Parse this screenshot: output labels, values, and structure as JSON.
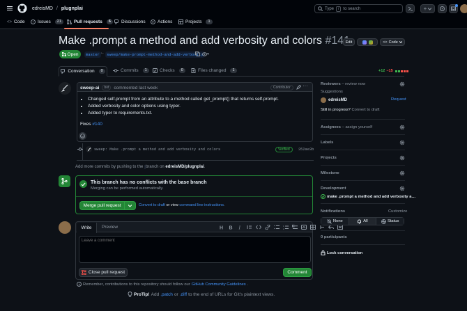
{
  "header": {
    "owner": "edreisMD",
    "slash": "/",
    "repo": "plugnplai",
    "search_placeholder_pre": "Type",
    "search_key": "/",
    "search_placeholder_post": "to search",
    "plus": "+"
  },
  "tabs": [
    {
      "label": "Code",
      "count": ""
    },
    {
      "label": "Issues",
      "count": "21"
    },
    {
      "label": "Pull requests",
      "count": "6"
    },
    {
      "label": "Discussions",
      "count": ""
    },
    {
      "label": "Actions",
      "count": ""
    },
    {
      "label": "Projects",
      "count": "1"
    }
  ],
  "pr": {
    "title": "Make .prompt a method and add verbosity and colors",
    "number": "#141",
    "state": "Open",
    "base": "master",
    "head": "sweep/make-prompt-method-and-add-verbosity",
    "edit": "Edit",
    "code": "Code"
  },
  "prtabs": [
    {
      "label": "Conversation",
      "count": "0"
    },
    {
      "label": "Commits",
      "count": "1"
    },
    {
      "label": "Checks",
      "count": "0"
    },
    {
      "label": "Files changed",
      "count": "1"
    }
  ],
  "diffstat": {
    "add": "+12",
    "del": "−15"
  },
  "comment": {
    "author": "sweep-ai",
    "bot": "bot",
    "time": "commented last week",
    "role": "Contributor",
    "bullets": [
      "Changed self.prompt from an attribute to a method called get_prompt() that returns self.prompt.",
      "Added verbosity and color options using typer.",
      "Added typer to requirements.txt."
    ],
    "fixes_label": "Fixes",
    "fixes_link": "#140"
  },
  "commit": {
    "message": "sweep: Make .prompt a method and add verbosity and colors",
    "status": "Verified",
    "sha": "352ae3b"
  },
  "morecommits": {
    "pre": "Add more commits by pushing to the",
    "branch": "sweep/make-prompt-method-and-add-verbosity",
    "mid": "branch on",
    "repo": "edreisMD/plugnplai",
    "end": "."
  },
  "merge": {
    "title": "This branch has no conflicts with the base branch",
    "subtitle": "Merging can be performed automatically.",
    "button": "Merge pull request",
    "alt_pre": "You can also",
    "open_in": "Convert to draft",
    "or": "or view",
    "cli": "command line instructions",
    "end": "."
  },
  "editor": {
    "write": "Write",
    "preview": "Preview",
    "placeholder": "Leave a comment",
    "close": "Close pull request",
    "comment": "Comment"
  },
  "footer": {
    "remember_pre": "Remember, contributions to this repository should follow our",
    "guidelines": "GitHub Community Guidelines",
    "remember_end": ".",
    "protip": "ProTip!",
    "tip_pre": "Add",
    "patch": ".patch",
    "or": "or",
    "diff": ".diff",
    "tip_end": "to the end of URLs for Git's plaintext views."
  },
  "sidebar": {
    "reviewers": "Reviewers",
    "reviewers_note": "– review now",
    "suggestions": "Suggestions",
    "suggest_user": "edreisMD",
    "request": "Request",
    "still": "Still in progress?",
    "convert": "Convert to draft",
    "assignees": "Assignees",
    "assignees_note": "– assign yourself",
    "labels": "Labels",
    "projects": "Projects",
    "milestone": "Milestone",
    "development": "Development",
    "dev_item": "make .prompt a method and add verbosity a…",
    "notifications": "Notifications",
    "customize": "Customize",
    "notif_opts": [
      "None",
      "All",
      "Status"
    ],
    "participants": "0 participants",
    "lock": "Lock conversation"
  }
}
